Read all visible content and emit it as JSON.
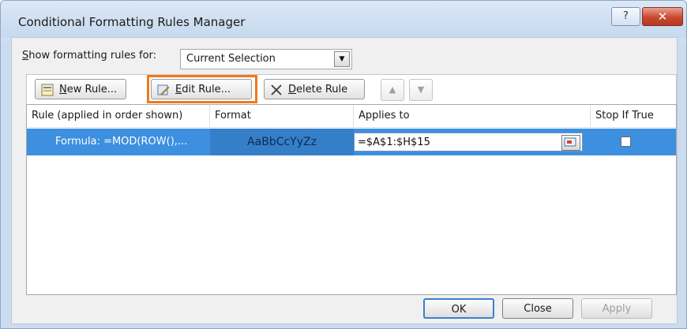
{
  "window": {
    "title": "Conditional Formatting Rules Manager",
    "help": "?",
    "close": "✕"
  },
  "show_for": {
    "label_prefix": "S",
    "label_rest": "how formatting rules for:",
    "value": "Current Selection"
  },
  "toolbar": {
    "new_rule_u": "N",
    "new_rule_rest": "ew Rule...",
    "edit_rule_u": "E",
    "edit_rule_rest": "dit Rule...",
    "delete_rule_u": "D",
    "delete_rule_rest": "elete Rule",
    "move_up": "▲",
    "move_down": "▼"
  },
  "columns": {
    "rule": "Rule (applied in order shown)",
    "format": "Format",
    "applies": "Applies to",
    "stop": "Stop If True"
  },
  "rules": [
    {
      "rule": "Formula: =MOD(ROW(),...",
      "format_preview": "AaBbCcYyZz",
      "applies_to": "=$A$1:$H$15",
      "stop_if_true": false
    }
  ],
  "buttons": {
    "ok": "OK",
    "close": "Close",
    "apply": "Apply"
  },
  "colors": {
    "selection": "#3d8fdf",
    "highlight_border": "#ee7a1f",
    "close_button": "#c9482f"
  }
}
